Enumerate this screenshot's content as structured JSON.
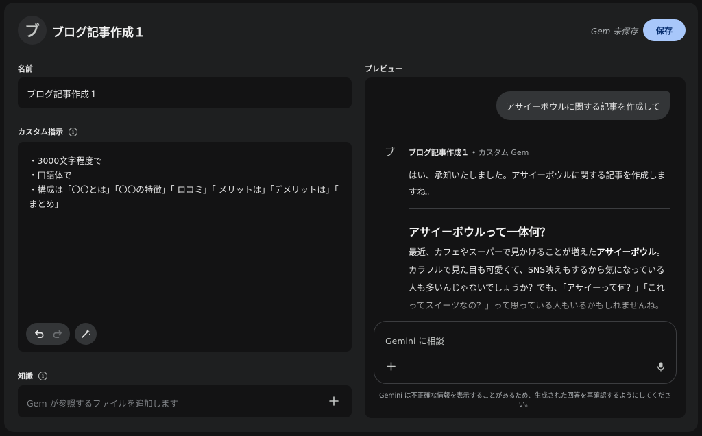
{
  "header": {
    "avatar_letter": "ブ",
    "title": "ブログ記事作成１",
    "status": "Gem 未保存",
    "save_label": "保存"
  },
  "form": {
    "name_label": "名前",
    "name_value": "ブログ記事作成１",
    "instructions_label": "カスタム指示",
    "instructions_text": "・3000文字程度で\n・口語体で\n・構成は「〇〇とは」「〇〇の特徴」「 ロコミ」「 メリットは」「デメリットは」「 まとめ」",
    "knowledge_label": "知識",
    "knowledge_placeholder": "Gem が参照するファイルを追加します"
  },
  "preview": {
    "label": "プレビュー",
    "user_message": "アサイーボウルに関する記事を作成して",
    "gem_avatar": "ブ",
    "gem_name": "ブログ記事作成１",
    "gem_subtitle": "• カスタム Gem",
    "response_intro": "はい、承知いたしました。アサイーボウルに関する記事を作成しますね。",
    "response_heading": "アサイーボウルって一体何？",
    "response_body_1": "最近、カフェやスーパーで見かけることが増えた",
    "response_body_bold": "アサイーボウル",
    "response_body_2": "。カラフルで見た目も可愛くて、SNS映えもするから気になっている人も多いんじゃないでしょうか？でも、「アサイーって何？」「これってスイーツなの？」って思っている人もいるかもしれませんね。",
    "input_placeholder": "Gemini に相談",
    "disclaimer": "Gemini は不正確な情報を表示することがあるため、生成された回答を再確認するようにしてください。"
  },
  "colors": {
    "background": "#131314",
    "surface": "#1e1f20",
    "accent": "#a8c7fa",
    "accent_text": "#062e6f"
  },
  "icons": [
    "undo-icon",
    "redo-icon",
    "magic-wand-icon",
    "info-icon",
    "plus-icon",
    "mic-icon"
  ]
}
